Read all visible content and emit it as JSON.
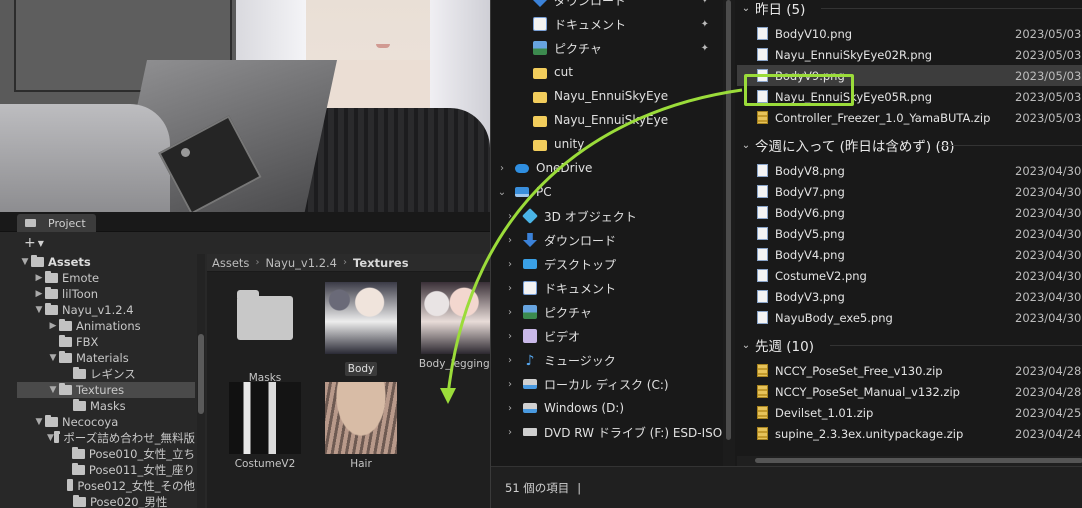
{
  "project": {
    "tab_label": "Project",
    "add_label": "+",
    "tree": [
      {
        "label": "Assets",
        "depth": 0,
        "open": true,
        "bold": true
      },
      {
        "label": "Emote",
        "depth": 1,
        "open": false
      },
      {
        "label": "lilToon",
        "depth": 1,
        "open": false
      },
      {
        "label": "Nayu_v1.2.4",
        "depth": 1,
        "open": true
      },
      {
        "label": "Animations",
        "depth": 2,
        "open": false
      },
      {
        "label": "FBX",
        "depth": 2,
        "leaf": true
      },
      {
        "label": "Materials",
        "depth": 2,
        "open": true
      },
      {
        "label": "レギンス",
        "depth": 3,
        "leaf": true
      },
      {
        "label": "Textures",
        "depth": 2,
        "open": true,
        "selected": true
      },
      {
        "label": "Masks",
        "depth": 3,
        "leaf": true
      },
      {
        "label": "Necocoya",
        "depth": 1,
        "open": true
      },
      {
        "label": "ポーズ詰め合わせ_無料版",
        "depth": 2,
        "open": true
      },
      {
        "label": "Pose010_女性_立ち",
        "depth": 3,
        "leaf": true
      },
      {
        "label": "Pose011_女性_座り",
        "depth": 3,
        "leaf": true
      },
      {
        "label": "Pose012_女性_その他",
        "depth": 3,
        "leaf": true
      },
      {
        "label": "Pose020_男性",
        "depth": 3,
        "leaf": true
      }
    ],
    "breadcrumb": [
      "Assets",
      "Nayu_v1.2.4",
      "Textures"
    ],
    "assets": [
      {
        "name": "Masks",
        "kind": "folder"
      },
      {
        "name": "Body",
        "kind": "tex1",
        "highlighted": true
      },
      {
        "name": "Body_leggings",
        "kind": "tex2"
      },
      {
        "name": "CostumeV2",
        "kind": "tex3"
      },
      {
        "name": "Hair",
        "kind": "tex4"
      }
    ]
  },
  "explorer": {
    "nav": [
      {
        "label": "ダウンロード",
        "icon": "down",
        "pinned": true,
        "indent": 1
      },
      {
        "label": "ドキュメント",
        "icon": "doc",
        "pinned": true,
        "indent": 1
      },
      {
        "label": "ピクチャ",
        "icon": "pic",
        "pinned": true,
        "indent": 1
      },
      {
        "label": "cut",
        "icon": "fold",
        "indent": 1
      },
      {
        "label": "Nayu_EnnuiSkyEye",
        "icon": "fold",
        "indent": 1
      },
      {
        "label": "Nayu_EnnuiSkyEye",
        "icon": "fold",
        "indent": 1
      },
      {
        "label": "unity",
        "icon": "fold",
        "indent": 1
      },
      {
        "label": "OneDrive",
        "icon": "cloud",
        "chevron": "›",
        "indent": 0
      },
      {
        "label": "PC",
        "icon": "pc",
        "chevron": "⌄",
        "indent": 0
      },
      {
        "label": "3D オブジェクト",
        "icon": "3d",
        "chevron": "›",
        "indent": 1
      },
      {
        "label": "ダウンロード",
        "icon": "down",
        "chevron": "›",
        "indent": 1
      },
      {
        "label": "デスクトップ",
        "icon": "desk",
        "chevron": "›",
        "indent": 1
      },
      {
        "label": "ドキュメント",
        "icon": "doc",
        "chevron": "›",
        "indent": 1
      },
      {
        "label": "ピクチャ",
        "icon": "pic",
        "chevron": "›",
        "indent": 1
      },
      {
        "label": "ビデオ",
        "icon": "vid",
        "chevron": "›",
        "indent": 1
      },
      {
        "label": "ミュージック",
        "icon": "music",
        "chevron": "›",
        "indent": 1
      },
      {
        "label": "ローカル ディスク (C:)",
        "icon": "drive",
        "chevron": "›",
        "indent": 1
      },
      {
        "label": "Windows (D:)",
        "icon": "drive",
        "chevron": "›",
        "indent": 1
      },
      {
        "label": "DVD RW ドライブ (F:) ESD-ISO",
        "icon": "dvd",
        "chevron": "›",
        "indent": 1
      }
    ],
    "groups": [
      {
        "title": "昨日 (5)",
        "files": [
          {
            "name": "BodyV10.png",
            "date": "2023/05/03 2",
            "type": "png"
          },
          {
            "name": "Nayu_EnnuiSkyEye02R.png",
            "date": "2023/05/03 2",
            "type": "png"
          },
          {
            "name": "BodyV9.png",
            "date": "2023/05/03 1",
            "type": "png",
            "selected": true
          },
          {
            "name": "Nayu_EnnuiSkyEye05R.png",
            "date": "2023/05/03 1",
            "type": "png"
          },
          {
            "name": "Controller_Freezer_1.0_YamaBUTA.zip",
            "date": "2023/05/03 1",
            "type": "zip"
          }
        ]
      },
      {
        "title": "今週に入って (昨日は含めず) (8)",
        "files": [
          {
            "name": "BodyV8.png",
            "date": "2023/04/30 2",
            "type": "png"
          },
          {
            "name": "BodyV7.png",
            "date": "2023/04/30 2",
            "type": "png"
          },
          {
            "name": "BodyV6.png",
            "date": "2023/04/30 2",
            "type": "png"
          },
          {
            "name": "BodyV5.png",
            "date": "2023/04/30 2",
            "type": "png"
          },
          {
            "name": "BodyV4.png",
            "date": "2023/04/30 2",
            "type": "png"
          },
          {
            "name": "CostumeV2.png",
            "date": "2023/04/30 2",
            "type": "png"
          },
          {
            "name": "BodyV3.png",
            "date": "2023/04/30 2",
            "type": "png"
          },
          {
            "name": "NayuBody_exe5.png",
            "date": "2023/04/30 1",
            "type": "png"
          }
        ]
      },
      {
        "title": "先週 (10)",
        "files": [
          {
            "name": "NCCY_PoseSet_Free_v130.zip",
            "date": "2023/04/28 1",
            "type": "zip"
          },
          {
            "name": "NCCY_PoseSet_Manual_v132.zip",
            "date": "2023/04/28 1",
            "type": "zip"
          },
          {
            "name": "Devilset_1.01.zip",
            "date": "2023/04/25 0",
            "type": "zip"
          },
          {
            "name": "supine_2.3.3ex.unitypackage.zip",
            "date": "2023/04/24 2",
            "type": "zip"
          }
        ]
      }
    ],
    "status": "51 個の項目",
    "status_sep": "|"
  },
  "colors": {
    "highlight": "#9bdc3a"
  }
}
